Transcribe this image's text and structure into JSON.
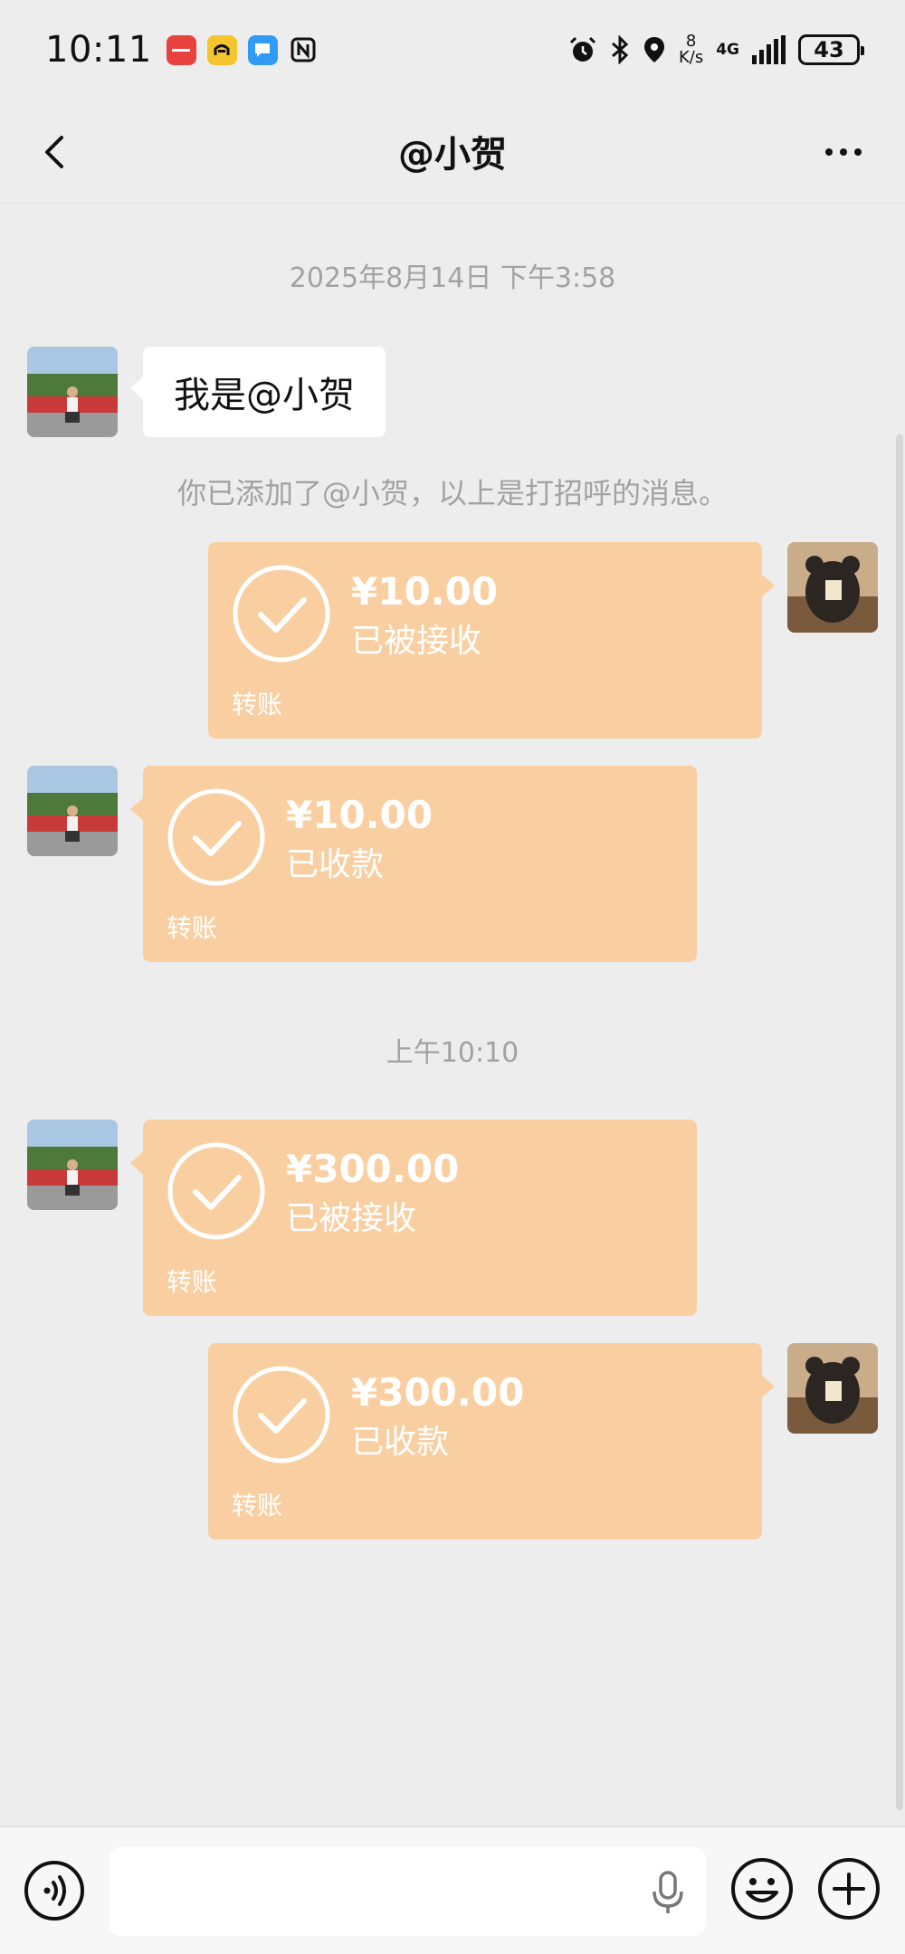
{
  "status_bar": {
    "time": "10:11",
    "net_speed_value": "8",
    "net_speed_unit": "K/s",
    "network_type": "4G",
    "battery_level": "43",
    "app_icons": [
      {
        "name": "huawei-store-icon",
        "color": "#e8423f"
      },
      {
        "name": "car-app-icon",
        "color": "#f5c52d"
      },
      {
        "name": "message-app-icon",
        "color": "#2f9bf5"
      },
      {
        "name": "nfc-icon",
        "color": "#111111"
      }
    ]
  },
  "nav": {
    "title": "@小贺"
  },
  "messages": {
    "timestamp_1": "2025年8月14日 下午3:58",
    "greeting_text": "我是@小贺",
    "system_notice": "你已添加了@小贺，以上是打招呼的消息。",
    "timestamp_2": "上午10:10",
    "transfers": [
      {
        "side": "right",
        "amount": "¥10.00",
        "status": "已被接收",
        "label": "转账"
      },
      {
        "side": "left",
        "amount": "¥10.00",
        "status": "已收款",
        "label": "转账"
      },
      {
        "side": "left",
        "amount": "¥300.00",
        "status": "已被接收",
        "label": "转账"
      },
      {
        "side": "right",
        "amount": "¥300.00",
        "status": "已收款",
        "label": "转账"
      }
    ]
  },
  "colors": {
    "transfer_bubble": "#f9cfa1",
    "chat_background": "#ededed",
    "text_bubble": "#ffffff",
    "muted_text": "#a2a2a2"
  }
}
